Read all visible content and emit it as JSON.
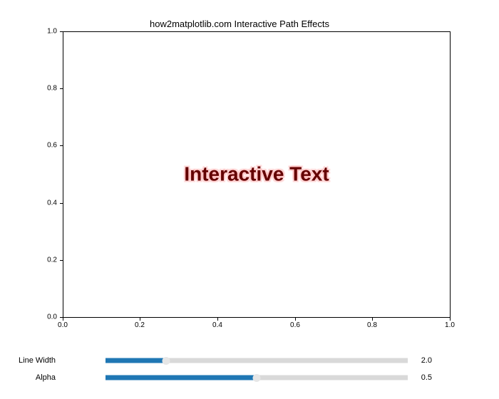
{
  "chart_data": {
    "type": "scatter",
    "title": "how2matplotlib.com Interactive Path Effects",
    "xlabel": "",
    "ylabel": "",
    "xlim": [
      0.0,
      1.0
    ],
    "ylim": [
      0.0,
      1.0
    ],
    "xticks": [
      0.0,
      0.2,
      0.4,
      0.6,
      0.8,
      1.0
    ],
    "yticks": [
      0.0,
      0.2,
      0.4,
      0.6,
      0.8,
      1.0
    ],
    "center_text": "Interactive Text",
    "series": []
  },
  "sliders": {
    "line_width": {
      "label": "Line Width",
      "min": 0,
      "max": 10,
      "value": 2.0,
      "display": "2.0",
      "frac": 0.2
    },
    "alpha": {
      "label": "Alpha",
      "min": 0,
      "max": 1,
      "value": 0.5,
      "display": "0.5",
      "frac": 0.5
    }
  },
  "tick_labels": {
    "x": [
      "0.0",
      "0.2",
      "0.4",
      "0.6",
      "0.8",
      "1.0"
    ],
    "y": [
      "0.0",
      "0.2",
      "0.4",
      "0.6",
      "0.8",
      "1.0"
    ]
  }
}
